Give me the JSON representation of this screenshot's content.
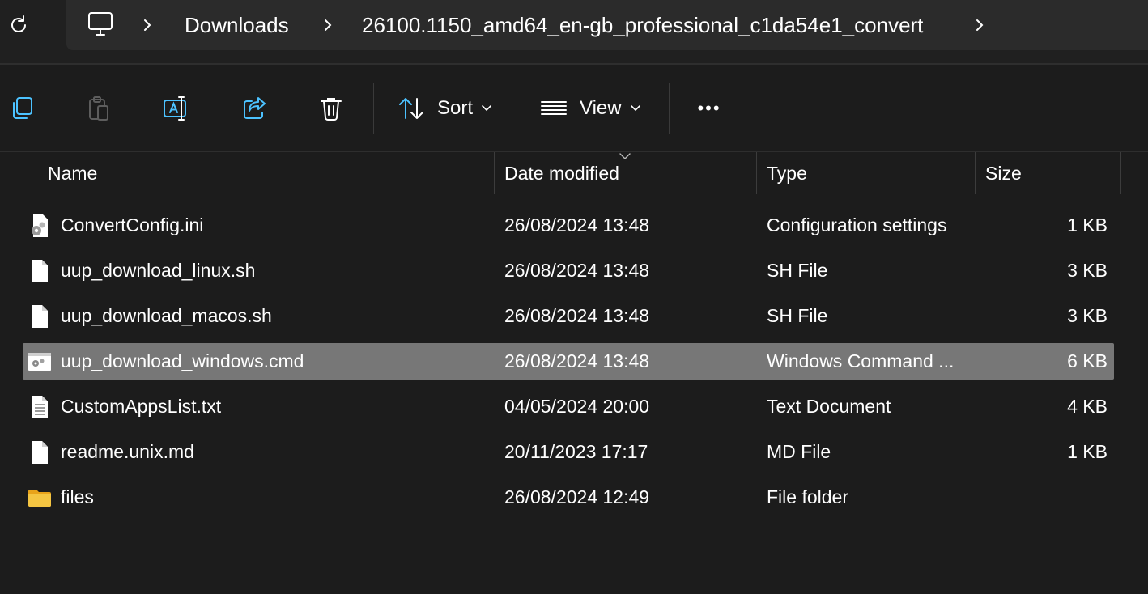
{
  "address_bar": {
    "crumbs": [
      "Downloads",
      "26100.1150_amd64_en-gb_professional_c1da54e1_convert"
    ],
    "root_icon": "monitor-icon"
  },
  "toolbar": {
    "sort_label": "Sort",
    "view_label": "View",
    "more_label": "•••"
  },
  "columns": {
    "name": "Name",
    "date": "Date modified",
    "type": "Type",
    "size": "Size"
  },
  "files": [
    {
      "name": "ConvertConfig.ini",
      "date": "26/08/2024 13:48",
      "type": "Configuration settings",
      "size": "1 KB",
      "icon": "config-file-icon",
      "selected": false
    },
    {
      "name": "uup_download_linux.sh",
      "date": "26/08/2024 13:48",
      "type": "SH File",
      "size": "3 KB",
      "icon": "file-icon",
      "selected": false
    },
    {
      "name": "uup_download_macos.sh",
      "date": "26/08/2024 13:48",
      "type": "SH File",
      "size": "3 KB",
      "icon": "file-icon",
      "selected": false
    },
    {
      "name": "uup_download_windows.cmd",
      "date": "26/08/2024 13:48",
      "type": "Windows Command ...",
      "size": "6 KB",
      "icon": "cmd-file-icon",
      "selected": true
    },
    {
      "name": "CustomAppsList.txt",
      "date": "04/05/2024 20:00",
      "type": "Text Document",
      "size": "4 KB",
      "icon": "text-file-icon",
      "selected": false
    },
    {
      "name": "readme.unix.md",
      "date": "20/11/2023 17:17",
      "type": "MD File",
      "size": "1 KB",
      "icon": "file-icon",
      "selected": false
    },
    {
      "name": "files",
      "date": "26/08/2024 12:49",
      "type": "File folder",
      "size": "",
      "icon": "folder-icon",
      "selected": false
    }
  ],
  "colors": {
    "accent": "#4cc2ff",
    "background": "#1c1c1c",
    "selection": "#777777",
    "folder": "#f4c542"
  }
}
